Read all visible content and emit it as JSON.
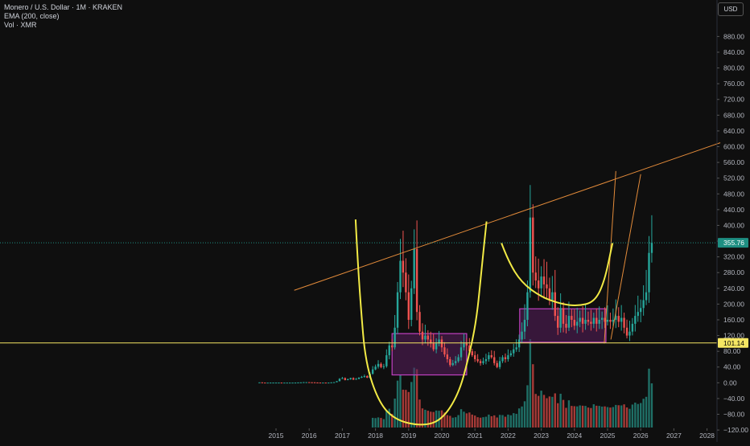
{
  "legend": {
    "symbol": "Monero / U.S. Dollar · 1M · KRAKEN",
    "ema": "EMA (200, close)",
    "volume": "Vol · XMR"
  },
  "currency_button": "USD",
  "colors": {
    "background": "#0f0f0f",
    "up": "#26a69a",
    "down": "#ef5350",
    "vol_up": "#1f6f66",
    "vol_down": "#a53a37",
    "trend": "#e38b3a",
    "support": "#f5e663",
    "price_tag": "#1e8f82",
    "box_stroke": "#c040c0",
    "box_fill": "#5a1f5e"
  },
  "chart_data": {
    "type": "candlestick",
    "interval": "1M",
    "ylim": [
      -130,
      940
    ],
    "y_ticks": [
      -120,
      -80,
      -40,
      0,
      40,
      80,
      120,
      160,
      200,
      240,
      280,
      320,
      360,
      400,
      440,
      480,
      520,
      560,
      600,
      640,
      680,
      720,
      760,
      800,
      840,
      880
    ],
    "y_tick_labels": [
      "−120.00",
      "−80.00",
      "−40.00",
      "0.00",
      "40.00",
      "80.00",
      "120.00",
      "160.00",
      "200.00",
      "240.00",
      "280.00",
      "320.00",
      "360.00",
      "400.00",
      "440.00",
      "480.00",
      "520.00",
      "560.00",
      "600.00",
      "640.00",
      "680.00",
      "720.00",
      "760.00",
      "800.00",
      "840.00",
      "880.00"
    ],
    "x_ticks": [
      2015,
      2016,
      2017,
      2018,
      2019,
      2020,
      2021,
      2022,
      2023,
      2024,
      2025,
      2026,
      2027,
      2028
    ],
    "x_tick_labels": [
      "2015",
      "2016",
      "2017",
      "2018",
      "2019",
      "2020",
      "2021",
      "2022",
      "2023",
      "2024",
      "2025",
      "2026",
      "2027",
      "2028"
    ],
    "last_price": 355.76,
    "last_price_label": "355.76",
    "horizontal_line": 101.14,
    "horizontal_line_label": "101.14",
    "closes": [
      1,
      0.5,
      0.4,
      0.4,
      0.5,
      0.5,
      0.5,
      0.5,
      0.4,
      0.4,
      0.4,
      0.4,
      0.4,
      0.5,
      0.8,
      1,
      1.5,
      1.5,
      1.2,
      1.1,
      0.7,
      0.6,
      0.5,
      0.5,
      0.4,
      0.5,
      1,
      1.5,
      4,
      10,
      12,
      7,
      9,
      12,
      8,
      10,
      13,
      15,
      17,
      13,
      23,
      34,
      41,
      48,
      40,
      42,
      70,
      95,
      90,
      140,
      230,
      310,
      280,
      230,
      160,
      240,
      340,
      180,
      130,
      110,
      120,
      110,
      100,
      85,
      100,
      110,
      90,
      72,
      60,
      45,
      50,
      55,
      65,
      90,
      100,
      95,
      80,
      70,
      60,
      55,
      50,
      55,
      60,
      70,
      65,
      50,
      40,
      55,
      65,
      60,
      70,
      75,
      85,
      90,
      110,
      130,
      160,
      230,
      420,
      280,
      260,
      240,
      270,
      250,
      240,
      210,
      230,
      170,
      140,
      190,
      150,
      140,
      170,
      160,
      145,
      155,
      165,
      150,
      160,
      155,
      150,
      165,
      150,
      160,
      165,
      155,
      160,
      155,
      160,
      170,
      155,
      165,
      140,
      120,
      130,
      150,
      170,
      180,
      190,
      210,
      230,
      330,
      355.76
    ],
    "trendline": {
      "from": [
        2015.55,
        235
      ],
      "to": [
        2028.4,
        610
      ]
    },
    "boxes": [
      {
        "x": [
          2018.5,
          2020.75
        ],
        "y": [
          20,
          125
        ]
      },
      {
        "x": [
          2022.35,
          2024.95
        ],
        "y": [
          103,
          188
        ]
      }
    ],
    "channel": {
      "left": {
        "from": [
          2024.9,
          100
        ],
        "to": [
          2025.25,
          538
        ]
      },
      "right": {
        "from": [
          2025.1,
          110
        ],
        "to": [
          2026.0,
          530
        ]
      }
    },
    "cup_handle_curves": [
      "2017.4,415 2017.45,330 2017.55,200 2017.7,50 2018.1,-50 2018.6,-95 2019.4,-110 2020.0,-95 2020.5,-30 2020.8,60 2021.05,160 2021.2,290 2021.35,410",
      "2021.8,355 2022.0,310 2022.4,255 2023.0,218 2023.6,200 2024.1,195 2024.6,205 2024.9,255 2025.15,355"
    ]
  }
}
